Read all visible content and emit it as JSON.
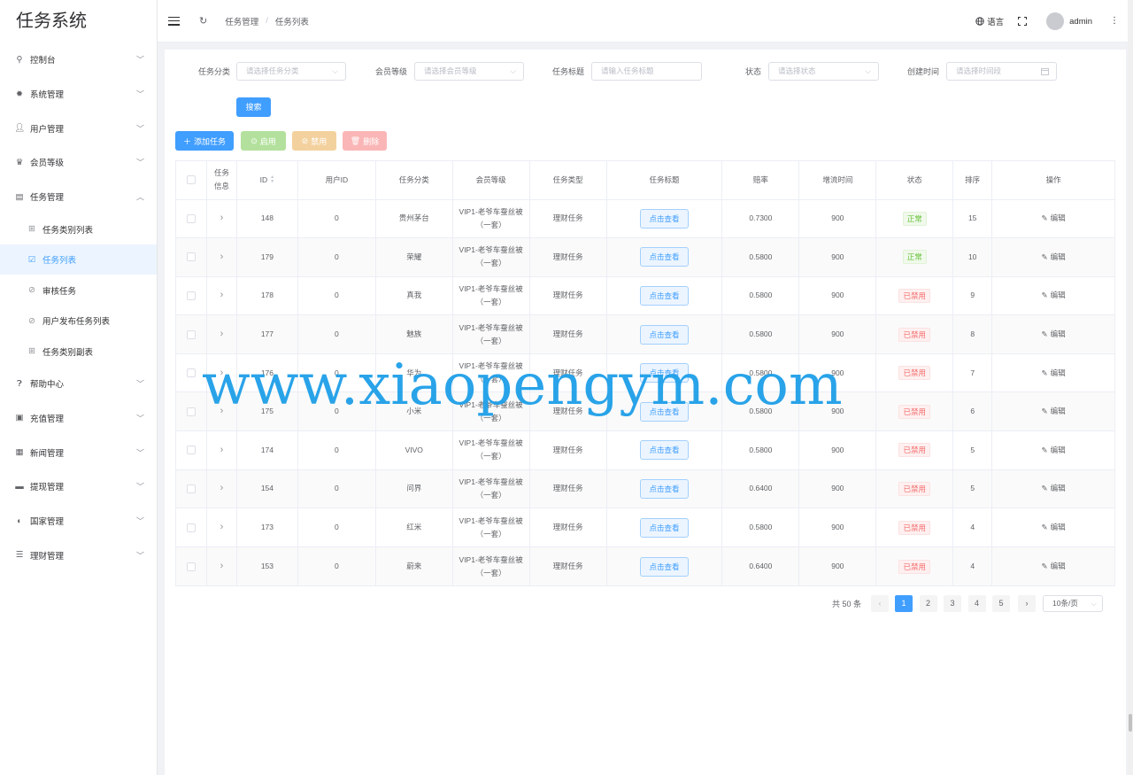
{
  "app": {
    "title": "任务系统"
  },
  "sidebar": {
    "items": [
      {
        "label": "控制台",
        "icon": "dashboard-icon",
        "expanded": false
      },
      {
        "label": "系统管理",
        "icon": "gear-icon",
        "expanded": false
      },
      {
        "label": "用户管理",
        "icon": "user-icon",
        "expanded": false
      },
      {
        "label": "会员等级",
        "icon": "crown-icon",
        "expanded": false
      },
      {
        "label": "任务管理",
        "icon": "clipboard-icon",
        "expanded": true
      },
      {
        "label": "帮助中心",
        "icon": "help-icon",
        "expanded": false
      },
      {
        "label": "充值管理",
        "icon": "wallet-icon",
        "expanded": false
      },
      {
        "label": "新闻管理",
        "icon": "news-icon",
        "expanded": false
      },
      {
        "label": "提现管理",
        "icon": "card-icon",
        "expanded": false
      },
      {
        "label": "国家管理",
        "icon": "globe-icon",
        "expanded": false
      },
      {
        "label": "理财管理",
        "icon": "database-icon",
        "expanded": false
      }
    ],
    "task_submenu": [
      {
        "label": "任务类别列表",
        "icon": "grid-icon",
        "active": false
      },
      {
        "label": "任务列表",
        "icon": "checklist-icon",
        "active": true
      },
      {
        "label": "审核任务",
        "icon": "check-circle-icon",
        "active": false
      },
      {
        "label": "用户发布任务列表",
        "icon": "check-circle-icon",
        "active": false
      },
      {
        "label": "任务类别副表",
        "icon": "grid-icon",
        "active": false
      }
    ]
  },
  "header": {
    "breadcrumb": [
      "任务管理",
      "任务列表"
    ],
    "language": "语言",
    "username": "admin"
  },
  "filters": {
    "category": {
      "label": "任务分类",
      "placeholder": "请选择任务分类"
    },
    "level": {
      "label": "会员等级",
      "placeholder": "请选择会员等级"
    },
    "title": {
      "label": "任务标题",
      "placeholder": "请输入任务标题"
    },
    "status": {
      "label": "状态",
      "placeholder": "请选择状态"
    },
    "created": {
      "label": "创建时间",
      "placeholder": "请选择时间段"
    },
    "search_label": "搜索"
  },
  "actions": {
    "add": "添加任务",
    "enable": "启用",
    "disable": "禁用",
    "delete": "删除"
  },
  "colors": {
    "primary": "#409eff",
    "success_light": "#b3e19d",
    "warning_light": "#f3d19e",
    "danger_light": "#fab6b6"
  },
  "table": {
    "headers": {
      "info": "任务信息",
      "id": "ID",
      "user_id": "用户ID",
      "category": "任务分类",
      "level": "会员等级",
      "type": "任务类型",
      "title": "任务标题",
      "rate": "赔率",
      "flow_time": "增流时间",
      "status": "状态",
      "sort": "排序",
      "ops": "操作"
    },
    "view_label": "点击查看",
    "edit_label": "编辑",
    "rows": [
      {
        "id": "148",
        "user_id": "0",
        "category": "贵州茅台",
        "level": "VIP1-老爷车蚕丝被（一套）",
        "type": "理财任务",
        "rate": "0.7300",
        "flow_time": "900",
        "status": "正常",
        "status_kind": "ok",
        "sort": "15"
      },
      {
        "id": "179",
        "user_id": "0",
        "category": "荣耀",
        "level": "VIP1-老爷车蚕丝被（一套）",
        "type": "理财任务",
        "rate": "0.5800",
        "flow_time": "900",
        "status": "正常",
        "status_kind": "ok",
        "sort": "10"
      },
      {
        "id": "178",
        "user_id": "0",
        "category": "真我",
        "level": "VIP1-老爷车蚕丝被（一套）",
        "type": "理财任务",
        "rate": "0.5800",
        "flow_time": "900",
        "status": "已禁用",
        "status_kind": "off",
        "sort": "9"
      },
      {
        "id": "177",
        "user_id": "0",
        "category": "魅族",
        "level": "VIP1-老爷车蚕丝被（一套）",
        "type": "理财任务",
        "rate": "0.5800",
        "flow_time": "900",
        "status": "已禁用",
        "status_kind": "off",
        "sort": "8"
      },
      {
        "id": "176",
        "user_id": "0",
        "category": "华为",
        "level": "VIP1-老爷车蚕丝被（一套）",
        "type": "理财任务",
        "rate": "0.5800",
        "flow_time": "900",
        "status": "已禁用",
        "status_kind": "off",
        "sort": "7"
      },
      {
        "id": "175",
        "user_id": "0",
        "category": "小米",
        "level": "VIP1-老爷车蚕丝被（一套）",
        "type": "理财任务",
        "rate": "0.5800",
        "flow_time": "900",
        "status": "已禁用",
        "status_kind": "off",
        "sort": "6"
      },
      {
        "id": "174",
        "user_id": "0",
        "category": "VIVO",
        "level": "VIP1-老爷车蚕丝被（一套）",
        "type": "理财任务",
        "rate": "0.5800",
        "flow_time": "900",
        "status": "已禁用",
        "status_kind": "off",
        "sort": "5"
      },
      {
        "id": "154",
        "user_id": "0",
        "category": "问界",
        "level": "VIP1-老爷车蚕丝被（一套）",
        "type": "理财任务",
        "rate": "0.6400",
        "flow_time": "900",
        "status": "已禁用",
        "status_kind": "off",
        "sort": "5"
      },
      {
        "id": "173",
        "user_id": "0",
        "category": "红米",
        "level": "VIP1-老爷车蚕丝被（一套）",
        "type": "理财任务",
        "rate": "0.5800",
        "flow_time": "900",
        "status": "已禁用",
        "status_kind": "off",
        "sort": "4"
      },
      {
        "id": "153",
        "user_id": "0",
        "category": "蔚来",
        "level": "VIP1-老爷车蚕丝被（一套）",
        "type": "理财任务",
        "rate": "0.6400",
        "flow_time": "900",
        "status": "已禁用",
        "status_kind": "off",
        "sort": "4"
      }
    ]
  },
  "pagination": {
    "total": "共 50 条",
    "pages": [
      "1",
      "2",
      "3",
      "4",
      "5"
    ],
    "current": "1",
    "page_size": "10条/页"
  },
  "watermark": "www.xiaopengym.com"
}
